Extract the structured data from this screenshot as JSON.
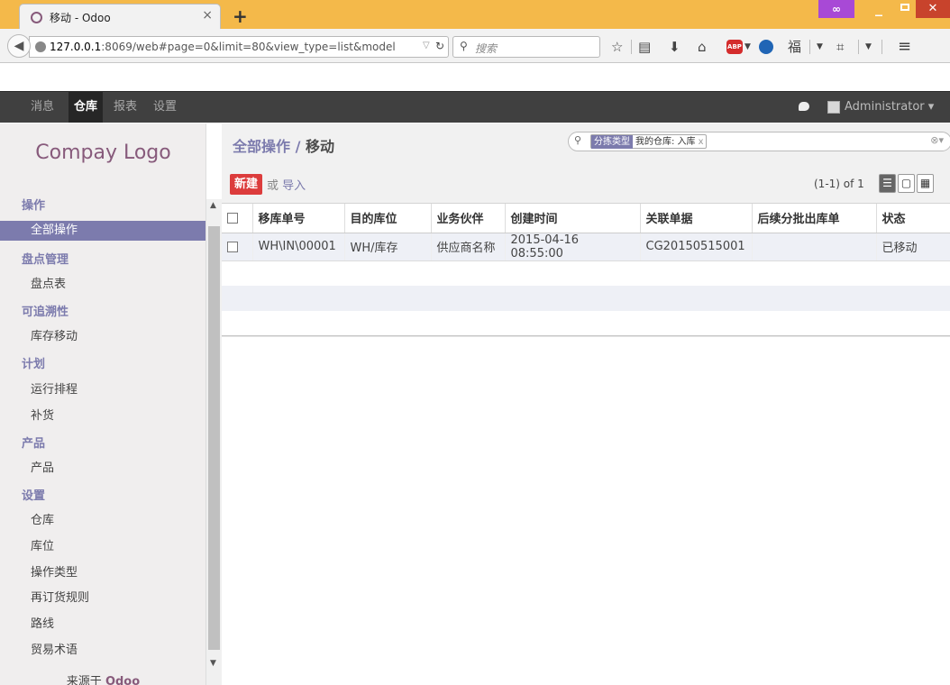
{
  "browser": {
    "tab_title": "移动 - Odoo",
    "tab_close": "×",
    "new_tab": "+",
    "url_host": "127.0.0.1",
    "url_rest": ":8069/web#page=0&limit=80&view_type=list&model",
    "search_placeholder": "搜索",
    "mask_label": "∞",
    "min_label": "_",
    "close_label": "✕"
  },
  "topmenu": {
    "items": [
      "消息",
      "仓库",
      "报表",
      "设置"
    ],
    "active_index": 1,
    "user": "Administrator ▾"
  },
  "sidebar": {
    "logo": "Compay Logo",
    "sections": [
      {
        "title": "操作",
        "items": [
          "全部操作"
        ]
      },
      {
        "title": "盘点管理",
        "items": [
          "盘点表"
        ]
      },
      {
        "title": "可追溯性",
        "items": [
          "库存移动"
        ]
      },
      {
        "title": "计划",
        "items": [
          "运行排程",
          "补货"
        ]
      },
      {
        "title": "产品",
        "items": [
          "产品"
        ]
      },
      {
        "title": "设置",
        "items": [
          "仓库",
          "库位",
          "操作类型",
          "再订货规则",
          "路线",
          "贸易术语"
        ]
      }
    ],
    "active_item": "全部操作",
    "footer_prefix": "来源于",
    "footer_brand": "Odoo"
  },
  "control_panel": {
    "breadcrumb_parent": "全部操作",
    "breadcrumb_sep": " / ",
    "breadcrumb_current": "移动",
    "facet_category": "分拣类型",
    "facet_value": "我的仓库: 入库",
    "facet_remove": "x",
    "new_button": "新建",
    "or_text": "或",
    "import_link": "导入",
    "pager": "(1-1) of 1"
  },
  "table": {
    "columns": [
      "移库单号",
      "目的库位",
      "业务伙伴",
      "创建时间",
      "关联单据",
      "后续分批出库单",
      "状态"
    ],
    "rows": [
      [
        "WH\\IN\\00001",
        "WH/库存",
        "供应商名称",
        "2015-04-16 08:55:00",
        "CG20150515001",
        "",
        "已移动"
      ]
    ]
  }
}
